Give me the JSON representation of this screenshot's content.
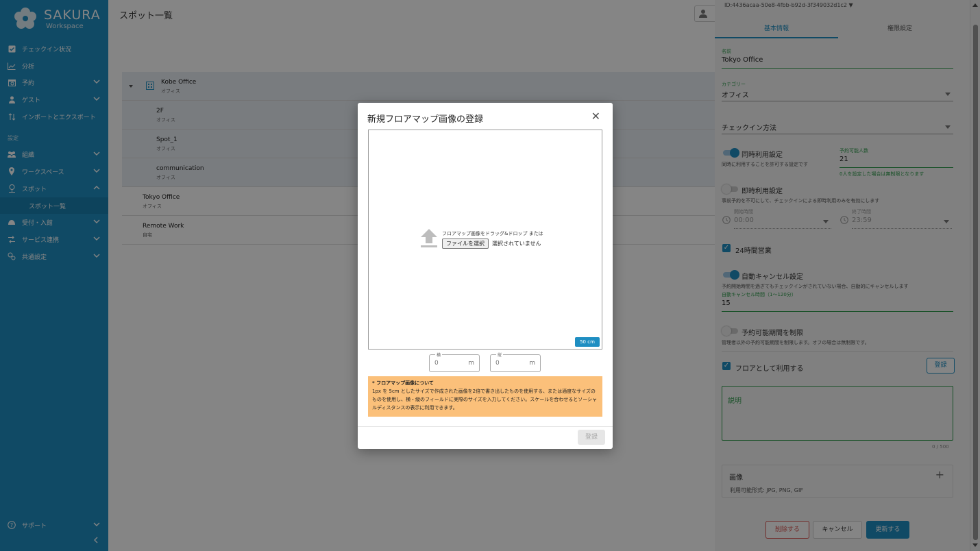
{
  "app": {
    "logo_title": "SAKURA",
    "logo_subtitle": "Workspace",
    "page_title": "スポット一覧"
  },
  "sidebar": {
    "items": [
      {
        "label": "チェックイン状況",
        "icon": "checkin-icon"
      },
      {
        "label": "分析",
        "icon": "chart-icon"
      },
      {
        "label": "予約",
        "icon": "calendar-icon"
      },
      {
        "label": "ゲスト",
        "icon": "guest-icon"
      },
      {
        "label": "インポートとエクスポート",
        "icon": "import-export-icon"
      }
    ],
    "section_settings": "設定",
    "settings_items": [
      {
        "label": "組織",
        "icon": "organization-icon"
      },
      {
        "label": "ワークスペース",
        "icon": "workspace-icon"
      },
      {
        "label": "スポット",
        "icon": "spot-icon"
      }
    ],
    "sub_item": "スポット一覧",
    "more_items": [
      {
        "label": "受付・入館",
        "icon": "reception-icon"
      },
      {
        "label": "サービス連携",
        "icon": "integration-icon"
      },
      {
        "label": "共通設定",
        "icon": "common-settings-icon"
      }
    ],
    "support": "サポート"
  },
  "tree": {
    "rows": [
      {
        "name": "Kobe Office",
        "type": "オフィス"
      },
      {
        "name": "2F",
        "type": "オフィス"
      },
      {
        "name": "Spot_1",
        "type": "オフィス"
      },
      {
        "name": "communication",
        "type": "オフィス"
      },
      {
        "name": "Tokyo Office",
        "type": "オフィス"
      },
      {
        "name": "Remote Work",
        "type": "自宅"
      }
    ]
  },
  "panel": {
    "id_text": "ID:4436acaa-50e8-4fbb-b92d-3f349032d1c2",
    "tabs": [
      "基本情報",
      "権限設定"
    ],
    "name_label": "名前",
    "name_value": "Tokyo Office",
    "category_label": "カテゴリー",
    "category_value": "オフィス",
    "checkin_method": "チェックイン方法",
    "concurrent_label": "同時利用設定",
    "concurrent_desc": "同時に利用することを許可する設定です",
    "capacity_label": "予約可能人数",
    "capacity_value": "21",
    "capacity_hint": "0人を設定した場合は無制限となります",
    "instant_label": "即時利用設定",
    "instant_desc": "事前予約を不可にして、チェックインによる即時利用のみを有効にします",
    "start_label": "開始時間",
    "start_value": "00:00",
    "end_label": "終了時間",
    "end_value": "23:59",
    "hours24": "24時間営業",
    "autocancel_label": "自動キャンセル設定",
    "autocancel_desc": "予約開始時間を過ぎてもチェックインがされていない場合、自動的にキャンセルします",
    "autocancel_time_label": "自動キャンセル時間（1～120分）",
    "autocancel_time_value": "15",
    "limit_label": "予約可能期間を制限",
    "limit_desc": "管理者以外の予約可能期間を制限します。オフの場合は無制限です。",
    "floor_label": "フロアとして利用する",
    "floor_register": "登録",
    "desc_placeholder": "説明",
    "desc_counter": "0 / 500",
    "image_label": "画像",
    "image_formats": "利用可能形式: JPG, PNG, GIF",
    "delete_btn": "削除する",
    "cancel_btn": "キャンセル",
    "update_btn": "更新する"
  },
  "modal": {
    "title": "新規フロアマップ画像の登録",
    "drop_text": "フロアマップ画像をドラッグ&ドロップ または",
    "file_button": "ファイルを選択",
    "file_none": "選択されていません",
    "scale_badge": "50 cm",
    "width_label": "横",
    "width_value": "0",
    "height_label": "縦",
    "height_value": "0",
    "unit": "m",
    "note_title": "* フロアマップ画像について",
    "note_body": "1px を 5cm としたサイズで作成された画像を2倍で書き出したものを使用する、または適度なサイズのものを使用し、横・縦のフィールドに実際のサイズを入力してください。スケールを合わせるとソーシャルディスタンスの表示に利用できます。",
    "register_btn": "登録"
  },
  "colors": {
    "brand": "#1f8ec2",
    "field_green": "#2e9b4b",
    "note_bg": "#fbc07a",
    "danger": "#d9534f"
  }
}
